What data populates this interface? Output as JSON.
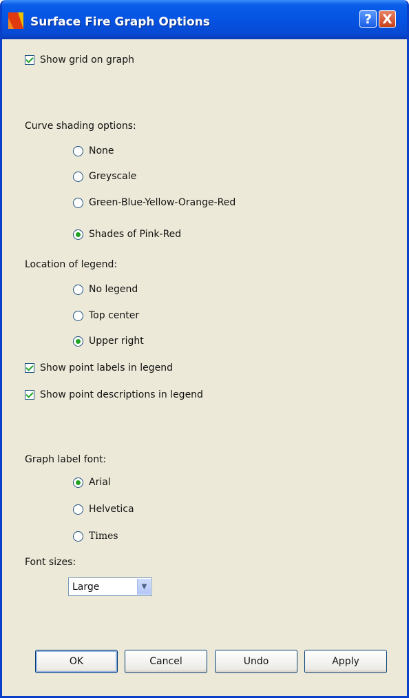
{
  "window": {
    "title": "Surface Fire Graph Options",
    "help_label": "?",
    "close_label": "X"
  },
  "show_grid": {
    "label": "Show grid on graph",
    "checked": true
  },
  "curve_shading": {
    "heading": "Curve shading options:",
    "options": [
      {
        "label": "None",
        "selected": false
      },
      {
        "label": "Greyscale",
        "selected": false
      },
      {
        "label": "Green-Blue-Yellow-Orange-Red",
        "selected": false
      },
      {
        "label": "Shades of Pink-Red",
        "selected": true
      }
    ]
  },
  "legend_location": {
    "heading": "Location of legend:",
    "options": [
      {
        "label": "No legend",
        "selected": false
      },
      {
        "label": "Top center",
        "selected": false
      },
      {
        "label": "Upper right",
        "selected": true
      }
    ]
  },
  "legend_checks": {
    "point_labels": {
      "label": "Show point labels in legend",
      "checked": true
    },
    "point_descriptions": {
      "label": "Show point descriptions in legend",
      "checked": true
    }
  },
  "graph_label_font": {
    "heading": "Graph label font:",
    "options": [
      {
        "label": "Arial",
        "selected": true
      },
      {
        "label": "Helvetica",
        "selected": false
      },
      {
        "label": "Times",
        "selected": false
      }
    ]
  },
  "font_sizes": {
    "heading": "Font sizes:",
    "value": "Large",
    "arrow": "▼"
  },
  "buttons": {
    "ok": "OK",
    "cancel": "Cancel",
    "undo": "Undo",
    "apply": "Apply"
  },
  "colors": {
    "title_bar": "#0553e3",
    "dialog_bg": "#ece9d8",
    "check_mark": "#21a121"
  },
  "icons": {
    "app": "flame-graph-icon",
    "help": "help-icon",
    "close": "close-icon"
  }
}
